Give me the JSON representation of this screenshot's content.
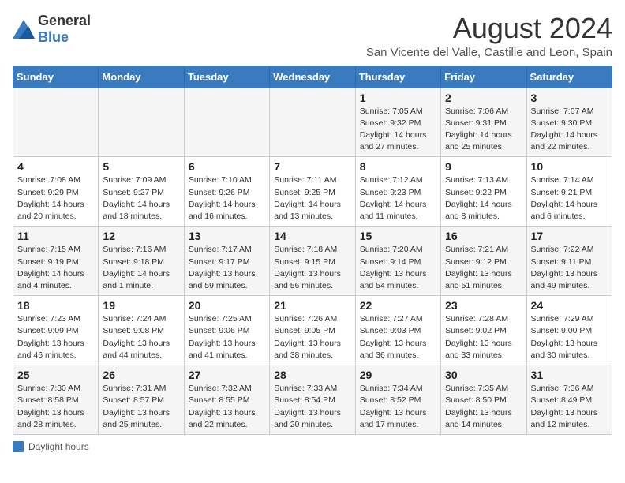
{
  "logo": {
    "general": "General",
    "blue": "Blue"
  },
  "title": "August 2024",
  "subtitle": "San Vicente del Valle, Castille and Leon, Spain",
  "days_of_week": [
    "Sunday",
    "Monday",
    "Tuesday",
    "Wednesday",
    "Thursday",
    "Friday",
    "Saturday"
  ],
  "weeks": [
    [
      {
        "day": "",
        "info": ""
      },
      {
        "day": "",
        "info": ""
      },
      {
        "day": "",
        "info": ""
      },
      {
        "day": "",
        "info": ""
      },
      {
        "day": "1",
        "info": "Sunrise: 7:05 AM\nSunset: 9:32 PM\nDaylight: 14 hours and 27 minutes."
      },
      {
        "day": "2",
        "info": "Sunrise: 7:06 AM\nSunset: 9:31 PM\nDaylight: 14 hours and 25 minutes."
      },
      {
        "day": "3",
        "info": "Sunrise: 7:07 AM\nSunset: 9:30 PM\nDaylight: 14 hours and 22 minutes."
      }
    ],
    [
      {
        "day": "4",
        "info": "Sunrise: 7:08 AM\nSunset: 9:29 PM\nDaylight: 14 hours and 20 minutes."
      },
      {
        "day": "5",
        "info": "Sunrise: 7:09 AM\nSunset: 9:27 PM\nDaylight: 14 hours and 18 minutes."
      },
      {
        "day": "6",
        "info": "Sunrise: 7:10 AM\nSunset: 9:26 PM\nDaylight: 14 hours and 16 minutes."
      },
      {
        "day": "7",
        "info": "Sunrise: 7:11 AM\nSunset: 9:25 PM\nDaylight: 14 hours and 13 minutes."
      },
      {
        "day": "8",
        "info": "Sunrise: 7:12 AM\nSunset: 9:23 PM\nDaylight: 14 hours and 11 minutes."
      },
      {
        "day": "9",
        "info": "Sunrise: 7:13 AM\nSunset: 9:22 PM\nDaylight: 14 hours and 8 minutes."
      },
      {
        "day": "10",
        "info": "Sunrise: 7:14 AM\nSunset: 9:21 PM\nDaylight: 14 hours and 6 minutes."
      }
    ],
    [
      {
        "day": "11",
        "info": "Sunrise: 7:15 AM\nSunset: 9:19 PM\nDaylight: 14 hours and 4 minutes."
      },
      {
        "day": "12",
        "info": "Sunrise: 7:16 AM\nSunset: 9:18 PM\nDaylight: 14 hours and 1 minute."
      },
      {
        "day": "13",
        "info": "Sunrise: 7:17 AM\nSunset: 9:17 PM\nDaylight: 13 hours and 59 minutes."
      },
      {
        "day": "14",
        "info": "Sunrise: 7:18 AM\nSunset: 9:15 PM\nDaylight: 13 hours and 56 minutes."
      },
      {
        "day": "15",
        "info": "Sunrise: 7:20 AM\nSunset: 9:14 PM\nDaylight: 13 hours and 54 minutes."
      },
      {
        "day": "16",
        "info": "Sunrise: 7:21 AM\nSunset: 9:12 PM\nDaylight: 13 hours and 51 minutes."
      },
      {
        "day": "17",
        "info": "Sunrise: 7:22 AM\nSunset: 9:11 PM\nDaylight: 13 hours and 49 minutes."
      }
    ],
    [
      {
        "day": "18",
        "info": "Sunrise: 7:23 AM\nSunset: 9:09 PM\nDaylight: 13 hours and 46 minutes."
      },
      {
        "day": "19",
        "info": "Sunrise: 7:24 AM\nSunset: 9:08 PM\nDaylight: 13 hours and 44 minutes."
      },
      {
        "day": "20",
        "info": "Sunrise: 7:25 AM\nSunset: 9:06 PM\nDaylight: 13 hours and 41 minutes."
      },
      {
        "day": "21",
        "info": "Sunrise: 7:26 AM\nSunset: 9:05 PM\nDaylight: 13 hours and 38 minutes."
      },
      {
        "day": "22",
        "info": "Sunrise: 7:27 AM\nSunset: 9:03 PM\nDaylight: 13 hours and 36 minutes."
      },
      {
        "day": "23",
        "info": "Sunrise: 7:28 AM\nSunset: 9:02 PM\nDaylight: 13 hours and 33 minutes."
      },
      {
        "day": "24",
        "info": "Sunrise: 7:29 AM\nSunset: 9:00 PM\nDaylight: 13 hours and 30 minutes."
      }
    ],
    [
      {
        "day": "25",
        "info": "Sunrise: 7:30 AM\nSunset: 8:58 PM\nDaylight: 13 hours and 28 minutes."
      },
      {
        "day": "26",
        "info": "Sunrise: 7:31 AM\nSunset: 8:57 PM\nDaylight: 13 hours and 25 minutes."
      },
      {
        "day": "27",
        "info": "Sunrise: 7:32 AM\nSunset: 8:55 PM\nDaylight: 13 hours and 22 minutes."
      },
      {
        "day": "28",
        "info": "Sunrise: 7:33 AM\nSunset: 8:54 PM\nDaylight: 13 hours and 20 minutes."
      },
      {
        "day": "29",
        "info": "Sunrise: 7:34 AM\nSunset: 8:52 PM\nDaylight: 13 hours and 17 minutes."
      },
      {
        "day": "30",
        "info": "Sunrise: 7:35 AM\nSunset: 8:50 PM\nDaylight: 13 hours and 14 minutes."
      },
      {
        "day": "31",
        "info": "Sunrise: 7:36 AM\nSunset: 8:49 PM\nDaylight: 13 hours and 12 minutes."
      }
    ]
  ],
  "footer": {
    "note": "Daylight hours"
  }
}
